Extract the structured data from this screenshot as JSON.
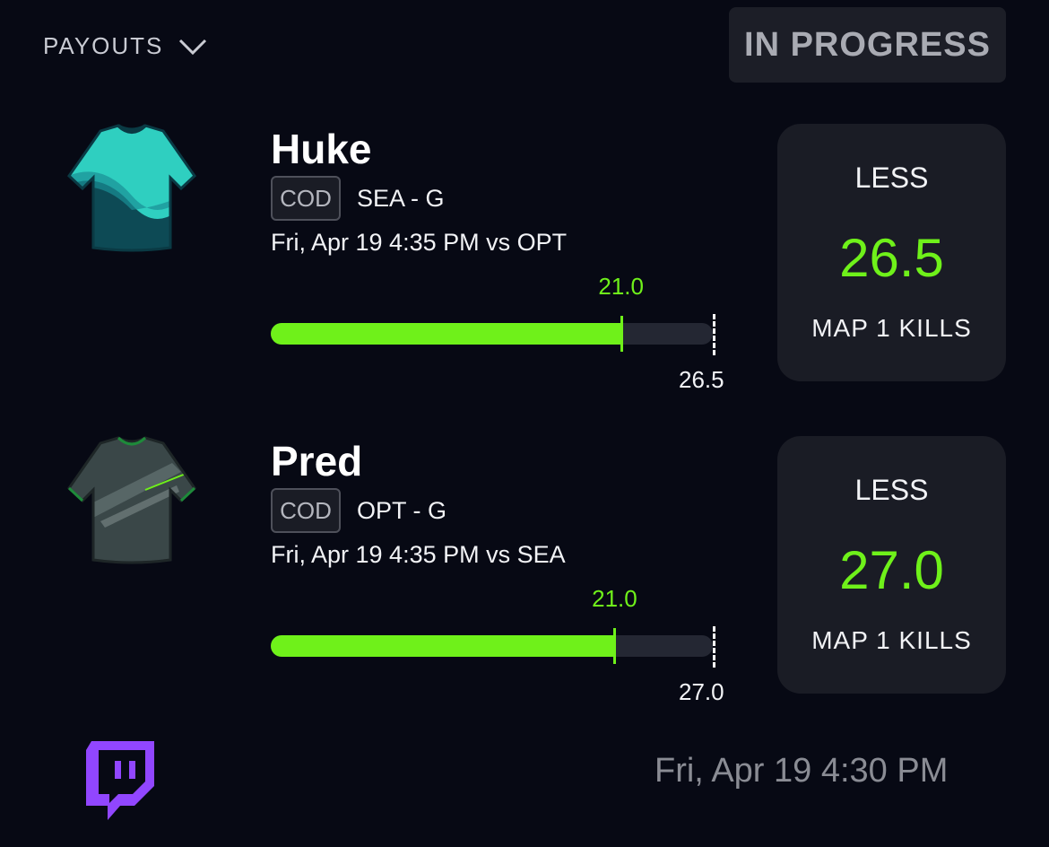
{
  "header": {
    "payouts_label": "PAYOUTS",
    "status": "IN PROGRESS"
  },
  "picks": [
    {
      "player": "Huke",
      "league": "COD",
      "team_pos": "SEA - G",
      "game_info": "Fri, Apr 19 4:35 PM  vs OPT",
      "current_label": "21.0",
      "line_label": "26.5",
      "current": 21.0,
      "line": 26.5,
      "direction": "LESS",
      "stat": "MAP 1 KILLS",
      "jersey_colors": {
        "body": "#2fcfc0",
        "light": "#4fe3d4",
        "dark": "#0d4a55",
        "trim": "#0a3a44"
      }
    },
    {
      "player": "Pred",
      "league": "COD",
      "team_pos": "OPT - G",
      "game_info": "Fri, Apr 19 4:35 PM  vs SEA",
      "current_label": "21.0",
      "line_label": "27.0",
      "current": 21.0,
      "line": 27.0,
      "direction": "LESS",
      "stat": "MAP 1 KILLS",
      "jersey_colors": {
        "body": "#3a4748",
        "light": "#5f6e6e",
        "dark": "#283233",
        "trim": "#1e8a3a"
      }
    }
  ],
  "footer": {
    "date": "Fri, Apr 19 4:30 PM",
    "stream_icon": "twitch-icon"
  },
  "colors": {
    "accent": "#6ff11a",
    "background": "#070914",
    "card": "#1a1c25",
    "twitch": "#9146ff"
  }
}
